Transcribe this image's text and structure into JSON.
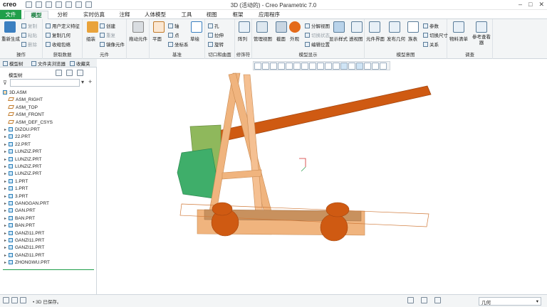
{
  "app": {
    "logo": "creo",
    "title": "3D (活动的) - Creo Parametric 7.0"
  },
  "tabs": [
    "文件",
    "模型",
    "分析",
    "实时仿真",
    "注释",
    "人体模型",
    "工具",
    "视图",
    "框架",
    "应用程序"
  ],
  "ribbon": {
    "groups": [
      {
        "label": "操作",
        "items": [
          "重新生成",
          "复制",
          "粘贴",
          "删除"
        ]
      },
      {
        "label": "获取数据",
        "items": [
          "用户定义特征",
          "复制几何",
          "收缩包络"
        ]
      },
      {
        "label": "元件",
        "items": [
          "组装",
          "创建",
          "重复",
          "镜像元件"
        ]
      },
      {
        "label": "",
        "items": [
          "拖动元件"
        ]
      },
      {
        "label": "基准",
        "items": [
          "平面",
          "轴",
          "点",
          "坐标系",
          "草绘"
        ]
      },
      {
        "label": "切口和曲面",
        "items": [
          "孔",
          "拉伸",
          "旋转"
        ]
      },
      {
        "label": "修饰符",
        "items": [
          "阵列"
        ]
      },
      {
        "label": "模型显示",
        "items": [
          "管理视图",
          "截面",
          "外观",
          "分解视图",
          "切换状态",
          "编辑位置",
          "显示样式",
          "透视图"
        ]
      },
      {
        "label": "模型意图",
        "items": [
          "元件界面",
          "发布几何",
          "族表",
          "参数",
          "切换尺寸",
          "关系"
        ]
      },
      {
        "label": "调查",
        "items": [
          "物料清单",
          "参考查看器"
        ]
      }
    ]
  },
  "panel": {
    "tabs": [
      "模型树",
      "文件夹浏览器",
      "收藏夹"
    ],
    "header": "模型树",
    "tree": [
      {
        "label": "3D.ASM",
        "type": "asm",
        "indent": 0
      },
      {
        "label": "ASM_RIGHT",
        "type": "plane",
        "indent": 1
      },
      {
        "label": "ASM_TOP",
        "type": "plane",
        "indent": 1
      },
      {
        "label": "ASM_FRONT",
        "type": "plane",
        "indent": 1
      },
      {
        "label": "ASM_DEF_CSYS",
        "type": "csys",
        "indent": 1
      },
      {
        "label": "DIZOU.PRT",
        "type": "part",
        "indent": 1
      },
      {
        "label": "22.PRT",
        "type": "part",
        "indent": 1
      },
      {
        "label": "22.PRT",
        "type": "part",
        "indent": 1
      },
      {
        "label": "LUNZIZ.PRT",
        "type": "part",
        "indent": 1
      },
      {
        "label": "LUNZIZ.PRT",
        "type": "part",
        "indent": 1
      },
      {
        "label": "LUNZIZ.PRT",
        "type": "part",
        "indent": 1
      },
      {
        "label": "LUNZIZ.PRT",
        "type": "part",
        "indent": 1
      },
      {
        "label": "1.PRT",
        "type": "part",
        "indent": 1
      },
      {
        "label": "1.PRT",
        "type": "part",
        "indent": 1
      },
      {
        "label": "3.PRT",
        "type": "part",
        "indent": 1
      },
      {
        "label": "GANGGAN.PRT",
        "type": "part",
        "indent": 1
      },
      {
        "label": "GAN.PRT",
        "type": "part",
        "indent": 1
      },
      {
        "label": "BAN.PRT",
        "type": "part",
        "indent": 1
      },
      {
        "label": "BAN.PRT",
        "type": "part",
        "indent": 1
      },
      {
        "label": "GANZI11.PRT",
        "type": "part",
        "indent": 1
      },
      {
        "label": "GANZI11.PRT",
        "type": "part",
        "indent": 1
      },
      {
        "label": "GANZI11.PRT",
        "type": "part",
        "indent": 1
      },
      {
        "label": "GANZI11.PRT",
        "type": "part",
        "indent": 1
      },
      {
        "label": "ZHONGWU.PRT",
        "type": "part",
        "indent": 1
      }
    ]
  },
  "status": {
    "message": "• 3D 已保存。",
    "filter": "几何"
  },
  "colors": {
    "brand": "#1f9f4a",
    "wood": "#f0b47e",
    "dark_wood": "#cf5a12",
    "green_part": "#3fae6a"
  }
}
